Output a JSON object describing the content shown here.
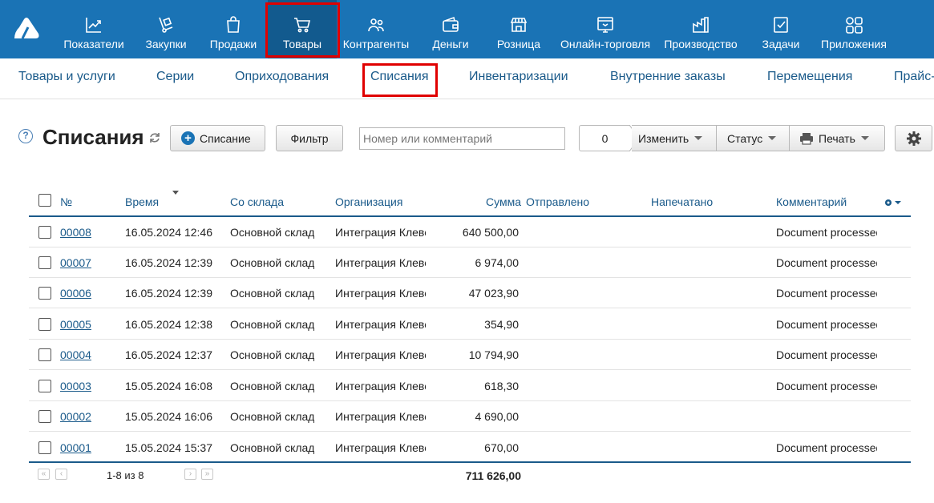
{
  "topnav": {
    "items": [
      {
        "label": "Показатели",
        "icon": "chart-line-icon"
      },
      {
        "label": "Закупки",
        "icon": "hand-truck-icon"
      },
      {
        "label": "Продажи",
        "icon": "shopping-bag-icon"
      },
      {
        "label": "Товары",
        "icon": "cart-icon",
        "active": true
      },
      {
        "label": "Контрагенты",
        "icon": "people-icon"
      },
      {
        "label": "Деньги",
        "icon": "wallet-icon"
      },
      {
        "label": "Розница",
        "icon": "storefront-icon"
      },
      {
        "label": "Онлайн-торговля",
        "icon": "online-shop-icon"
      },
      {
        "label": "Производство",
        "icon": "factory-icon"
      },
      {
        "label": "Задачи",
        "icon": "task-check-icon"
      },
      {
        "label": "Приложения",
        "icon": "apps-grid-icon"
      }
    ]
  },
  "subnav": {
    "items": [
      {
        "label": "Товары и услуги"
      },
      {
        "label": "Серии"
      },
      {
        "label": "Оприходования"
      },
      {
        "label": "Списания",
        "active": true
      },
      {
        "label": "Инвентаризации"
      },
      {
        "label": "Внутренние заказы"
      },
      {
        "label": "Перемещения"
      },
      {
        "label": "Прайс-"
      }
    ]
  },
  "toolbar": {
    "title": "Списания",
    "add_label": "Списание",
    "filter_label": "Фильтр",
    "search_placeholder": "Номер или комментарий",
    "selected_count": "0",
    "change_label": "Изменить",
    "status_label": "Статус",
    "print_label": "Печать"
  },
  "table": {
    "columns": {
      "number": "№",
      "time": "Время",
      "warehouse": "Со склада",
      "organization": "Организация",
      "sum": "Сумма",
      "sent": "Отправлено",
      "printed": "Напечатано",
      "comment": "Комментарий"
    },
    "rows": [
      {
        "number": "00008",
        "time": "16.05.2024 12:46",
        "warehouse": "Основной склад",
        "organization": "Интеграция Клевер",
        "sum": "640 500,00",
        "sent": "",
        "printed": "",
        "comment": "Document processed"
      },
      {
        "number": "00007",
        "time": "16.05.2024 12:39",
        "warehouse": "Основной склад",
        "organization": "Интеграция Клевер",
        "sum": "6 974,00",
        "sent": "",
        "printed": "",
        "comment": "Document processed"
      },
      {
        "number": "00006",
        "time": "16.05.2024 12:39",
        "warehouse": "Основной склад",
        "organization": "Интеграция Клевер",
        "sum": "47 023,90",
        "sent": "",
        "printed": "",
        "comment": "Document processed"
      },
      {
        "number": "00005",
        "time": "16.05.2024 12:38",
        "warehouse": "Основной склад",
        "organization": "Интеграция Клевер",
        "sum": "354,90",
        "sent": "",
        "printed": "",
        "comment": "Document processed"
      },
      {
        "number": "00004",
        "time": "16.05.2024 12:37",
        "warehouse": "Основной склад",
        "organization": "Интеграция Клевер",
        "sum": "10 794,90",
        "sent": "",
        "printed": "",
        "comment": "Document processed"
      },
      {
        "number": "00003",
        "time": "15.05.2024 16:08",
        "warehouse": "Основной склад",
        "organization": "Интеграция Клевер",
        "sum": "618,30",
        "sent": "",
        "printed": "",
        "comment": "Document processed"
      },
      {
        "number": "00002",
        "time": "15.05.2024 16:06",
        "warehouse": "Основной склад",
        "organization": "Интеграция Клевер",
        "sum": "4 690,00",
        "sent": "",
        "printed": "",
        "comment": ""
      },
      {
        "number": "00001",
        "time": "15.05.2024 15:37",
        "warehouse": "Основной склад",
        "organization": "Интеграция Клевер",
        "sum": "670,00",
        "sent": "",
        "printed": "",
        "comment": "Document processed"
      }
    ],
    "pagination": "1-8 из 8",
    "total": "711 626,00"
  },
  "colors": {
    "nav_bg": "#1a73b5",
    "nav_active_bg": "#125a8e",
    "link": "#1a5a8a",
    "highlight": "#e00000"
  }
}
